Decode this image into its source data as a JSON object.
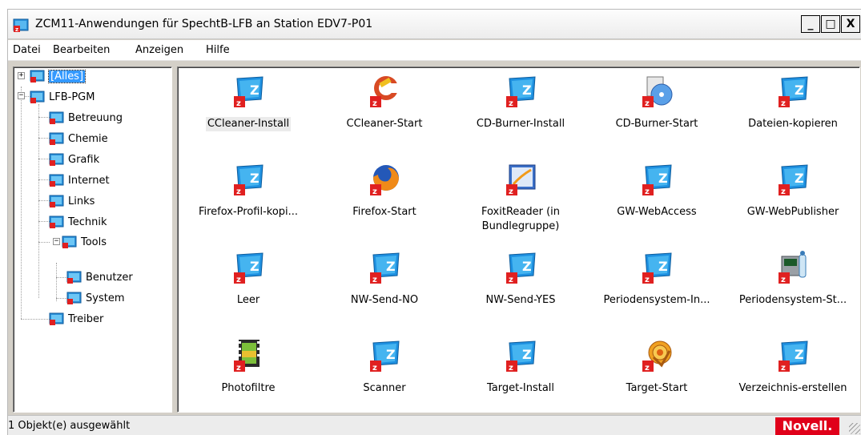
{
  "window": {
    "title": "ZCM11-Anwendungen für SpechtB-LFB an Station EDV7-P01",
    "controls": {
      "minimize": "_",
      "maximize": "□",
      "close": "X"
    }
  },
  "menu": [
    "Datei",
    "Bearbeiten",
    "Anzeigen",
    "Hilfe"
  ],
  "tree": {
    "root_all": "[Alles]",
    "folder": "LFB-PGM",
    "children": [
      "Betreuung",
      "Chemie",
      "Grafik",
      "Internet",
      "Links",
      "Technik",
      "Tools"
    ],
    "tools_children": [
      "Benutzer",
      "System"
    ],
    "last": "Treiber",
    "expand_symbol": "+",
    "collapse_symbol": "−"
  },
  "apps": [
    {
      "label": "CCleaner-Install",
      "icon": "zen-z-icon",
      "selected": true
    },
    {
      "label": "CCleaner-Start",
      "icon": "ccleaner-icon"
    },
    {
      "label": "CD-Burner-Install",
      "icon": "zen-z-icon"
    },
    {
      "label": "CD-Burner-Start",
      "icon": "cd-burner-icon"
    },
    {
      "label": "Dateien-kopieren",
      "icon": "zen-z-icon"
    },
    {
      "label": "Firefox-Profil-kopi...",
      "icon": "zen-z-icon"
    },
    {
      "label": "Firefox-Start",
      "icon": "firefox-icon"
    },
    {
      "label": "FoxitReader (in",
      "label2": "Bundlegruppe)",
      "icon": "foxit-icon"
    },
    {
      "label": "GW-WebAccess",
      "icon": "zen-z-icon"
    },
    {
      "label": "GW-WebPublisher",
      "icon": "zen-z-icon"
    },
    {
      "label": "Leer",
      "icon": "zen-z-icon"
    },
    {
      "label": "NW-Send-NO",
      "icon": "zen-z-icon"
    },
    {
      "label": "NW-Send-YES",
      "icon": "zen-z-icon"
    },
    {
      "label": "Periodensystem-In...",
      "icon": "zen-z-icon"
    },
    {
      "label": "Periodensystem-St...",
      "icon": "periodensystem-icon"
    },
    {
      "label": "Photofiltre",
      "icon": "photofiltre-icon"
    },
    {
      "label": "Scanner",
      "icon": "zen-z-icon"
    },
    {
      "label": "Target-Install",
      "icon": "zen-z-icon"
    },
    {
      "label": "Target-Start",
      "icon": "target-icon"
    },
    {
      "label": "Verzeichnis-erstellen",
      "icon": "zen-z-icon"
    }
  ],
  "status": {
    "text": "1 Objekt(e) ausgewählt",
    "brand": "Novell."
  },
  "colors": {
    "selection": "#3399ff",
    "brand": "#e0001a",
    "icon_blue": "#1e90e0",
    "icon_red": "#e02020"
  }
}
